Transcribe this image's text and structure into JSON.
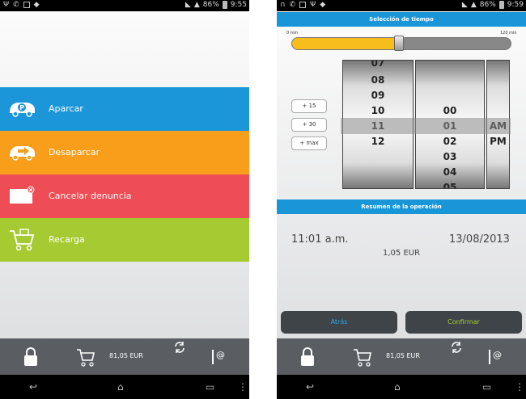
{
  "status": {
    "left_icons": [
      "Ψ",
      "✆"
    ],
    "battery": "86%",
    "time_left": "9:55",
    "time_right": "9:59"
  },
  "home": {
    "menu": [
      {
        "label": "Aparcar",
        "color": "#1a96d9",
        "icon": "parking-car-icon"
      },
      {
        "label": "Desaparcar",
        "color": "#f89e1b",
        "icon": "car-exit-icon"
      },
      {
        "label": "Cancelar denuncia",
        "color": "#ee4d55",
        "icon": "cancel-ticket-icon"
      },
      {
        "label": "Recarga",
        "color": "#a6cb32",
        "icon": "shopping-cart-icon"
      }
    ],
    "balance": "81,05 EUR"
  },
  "time": {
    "header": "Selección de tiempo",
    "slider_min": "0 min",
    "slider_max": "120 min",
    "slider_fraction": 0.49,
    "buttons": [
      "+ 15",
      "+ 30",
      "+ max"
    ],
    "hours": [
      "07",
      "08",
      "09",
      "10",
      "11",
      "12"
    ],
    "minutes": [
      "00",
      "01",
      "02",
      "03",
      "04",
      "05"
    ],
    "ampm": [
      "AM",
      "PM"
    ],
    "summary_header": "Resumen de la operación",
    "summary_time": "11:01 a.m.",
    "summary_date": "13/08/2013",
    "summary_amount": "1,05 EUR",
    "back_label": "Atrás",
    "confirm_label": "Confirmar",
    "balance": "81,05 EUR"
  }
}
